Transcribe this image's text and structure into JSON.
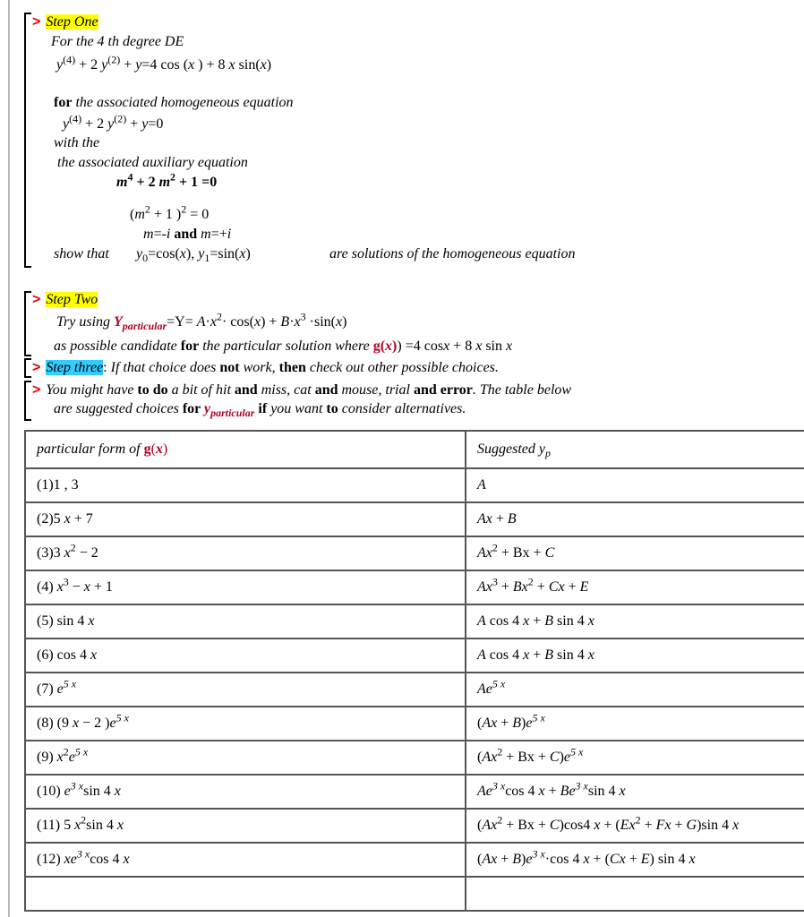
{
  "prompt": ">",
  "colors": {
    "prompt": "#e00000",
    "highlight_step": "#ffff00",
    "highlight_step_three": "#33ccff",
    "emphasis": "#b00020"
  },
  "step_one": {
    "title": [
      [
        "i hly",
        "Step One"
      ]
    ],
    "line1": [
      [
        "i",
        "For the 4 th degree DE"
      ]
    ],
    "de": [
      [
        "i",
        "y"
      ],
      [
        "sup",
        "(4)"
      ],
      [
        "",
        "  + 2 "
      ],
      [
        "i",
        "y"
      ],
      [
        "sup",
        "(2)"
      ],
      [
        "",
        "  + "
      ],
      [
        "i",
        "y"
      ],
      [
        "",
        "=4 cos ("
      ],
      [
        "i",
        "x"
      ],
      [
        "",
        " )  + 8 "
      ],
      [
        "i",
        "x"
      ],
      [
        "",
        " sin("
      ],
      [
        "i",
        "x"
      ],
      [
        "",
        ")"
      ]
    ],
    "line2": [
      [
        "b",
        "for"
      ],
      [
        "i",
        " the   associated homogeneous  equation"
      ]
    ],
    "hom": [
      [
        "i",
        "y"
      ],
      [
        "sup",
        "(4)"
      ],
      [
        "",
        "  + 2 "
      ],
      [
        "i",
        "y"
      ],
      [
        "sup",
        "(2)"
      ],
      [
        "",
        "  + "
      ],
      [
        "i",
        "y"
      ],
      [
        "",
        "=0"
      ]
    ],
    "line3": [
      [
        "i",
        "with the"
      ]
    ],
    "line4": [
      [
        "i",
        "the associated auxiliary equation"
      ]
    ],
    "aux": [
      [
        "b i",
        "m"
      ],
      [
        "b sup",
        "4"
      ],
      [
        "b",
        " + 2 "
      ],
      [
        "b i",
        "m"
      ],
      [
        "b sup",
        "2"
      ],
      [
        "b",
        " + 1 =0"
      ]
    ],
    "factored": [
      [
        "",
        "("
      ],
      [
        "i",
        "m"
      ],
      [
        "sup",
        "2"
      ],
      [
        "",
        " + 1 )"
      ],
      [
        "sup",
        "2"
      ],
      [
        "",
        "  =  0"
      ]
    ],
    "roots": [
      [
        "i",
        "m"
      ],
      [
        "",
        "=-"
      ],
      [
        "i",
        "i"
      ],
      [
        "b",
        "   and  "
      ],
      [
        "i",
        "m"
      ],
      [
        "",
        "=+"
      ],
      [
        "i",
        "i"
      ]
    ],
    "show_label": [
      [
        "i",
        "show that"
      ]
    ],
    "solutions": [
      [
        "i",
        "y"
      ],
      [
        "sub",
        "0"
      ],
      [
        "",
        "=cos("
      ],
      [
        "i",
        "x"
      ],
      [
        "",
        "),  "
      ],
      [
        "i",
        "y"
      ],
      [
        "sub",
        "1"
      ],
      [
        "",
        "=sin("
      ],
      [
        "i",
        "x"
      ],
      [
        "",
        ")"
      ]
    ],
    "conclusion": [
      [
        "i",
        "are solutions of the homogeneous equation"
      ]
    ]
  },
  "step_two": {
    "title": [
      [
        "i hly",
        "Step Two"
      ]
    ],
    "line1": [
      [
        "i",
        "Try  using    "
      ],
      [
        "b i red",
        "Y"
      ],
      [
        "b i red sub",
        "particular"
      ],
      [
        "",
        "=Y=   "
      ],
      [
        "i",
        "A"
      ],
      [
        "",
        "·"
      ],
      [
        "i",
        "x"
      ],
      [
        "sup",
        "2"
      ],
      [
        "",
        "·  cos("
      ],
      [
        "i",
        "x"
      ],
      [
        "",
        ")  + "
      ],
      [
        "i",
        "B"
      ],
      [
        "",
        "·"
      ],
      [
        "i",
        "x"
      ],
      [
        "sup",
        "3"
      ],
      [
        "",
        "  ·sin("
      ],
      [
        "i",
        "x"
      ],
      [
        "",
        ")"
      ]
    ],
    "line2": [
      [
        "i",
        "as possible candidate "
      ],
      [
        "b",
        "for"
      ],
      [
        "i",
        " the  particular solution  where  "
      ],
      [
        "b red",
        "g"
      ],
      [
        "b red",
        "("
      ],
      [
        "b i red",
        "x"
      ],
      [
        "b red",
        ")"
      ],
      [
        "",
        ") =4 cos"
      ],
      [
        "i",
        "x"
      ],
      [
        "",
        " + 8 "
      ],
      [
        "i",
        "x"
      ],
      [
        "",
        " sin "
      ],
      [
        "i",
        "x"
      ]
    ]
  },
  "step_three": {
    "line": [
      [
        "i hlb",
        "Step three"
      ],
      [
        "",
        ":  "
      ],
      [
        "i",
        "If that choice does "
      ],
      [
        "b",
        "not"
      ],
      [
        "i",
        " work, "
      ],
      [
        "b",
        "then"
      ],
      [
        "i",
        " check out other possible choices."
      ]
    ]
  },
  "note": {
    "line1": [
      [
        "i",
        "You might have "
      ],
      [
        "b",
        "to  do"
      ],
      [
        "i",
        " a bit of hit "
      ],
      [
        "b",
        "and"
      ],
      [
        "i",
        " miss, cat "
      ],
      [
        "b",
        "and"
      ],
      [
        "i",
        " mouse, trial "
      ],
      [
        "b",
        "and error"
      ],
      [
        "i",
        ". The table below"
      ]
    ],
    "line2": [
      [
        "i",
        "are suggested choices  "
      ],
      [
        "b",
        "for "
      ],
      [
        "b i red",
        "y"
      ],
      [
        "b i red sub",
        "particular"
      ],
      [
        "b",
        "    if "
      ],
      [
        "i",
        "you want "
      ],
      [
        "b",
        "to"
      ],
      [
        "i",
        " consider alternatives."
      ]
    ]
  },
  "table": {
    "headers": [
      [
        [
          "i",
          "particular form  of  "
        ],
        [
          "b red",
          "g"
        ],
        [
          "red",
          "("
        ],
        [
          "b i red",
          "x"
        ],
        [
          "red",
          ")"
        ]
      ],
      [
        [
          "i",
          "Suggested   y"
        ],
        [
          "i sub",
          "p"
        ]
      ]
    ],
    "rows": [
      [
        [
          [
            "",
            "(1)1 , 3"
          ]
        ],
        [
          [
            "i",
            "A"
          ]
        ]
      ],
      [
        [
          [
            "",
            "(2)5 "
          ],
          [
            "i",
            "x"
          ],
          [
            "",
            " + 7"
          ]
        ],
        [
          [
            "i",
            "Ax"
          ],
          [
            "",
            " + "
          ],
          [
            "i",
            "B"
          ]
        ]
      ],
      [
        [
          [
            "",
            "(3)3 "
          ],
          [
            "i",
            "x"
          ],
          [
            "sup",
            "2"
          ],
          [
            "",
            " − 2"
          ]
        ],
        [
          [
            "i",
            "Ax"
          ],
          [
            "sup",
            "2"
          ],
          [
            "",
            " + Bx + "
          ],
          [
            "i",
            "C"
          ]
        ]
      ],
      [
        [
          [
            "",
            "(4)  "
          ],
          [
            "i",
            "x"
          ],
          [
            "sup",
            "3"
          ],
          [
            "",
            " − "
          ],
          [
            "i",
            "x"
          ],
          [
            "",
            " + 1"
          ]
        ],
        [
          [
            "i",
            "Ax"
          ],
          [
            "sup",
            "3"
          ],
          [
            "",
            " + "
          ],
          [
            "i",
            "Bx"
          ],
          [
            "sup",
            "2"
          ],
          [
            "",
            " + "
          ],
          [
            "i",
            "Cx"
          ],
          [
            "",
            " + "
          ],
          [
            "i",
            "E"
          ]
        ]
      ],
      [
        [
          [
            "",
            "(5)  sin 4 "
          ],
          [
            "i",
            "x"
          ]
        ],
        [
          [
            "i",
            "A"
          ],
          [
            "",
            " cos 4 "
          ],
          [
            "i",
            "x"
          ],
          [
            "",
            " + "
          ],
          [
            "i",
            "B"
          ],
          [
            "",
            " sin 4 "
          ],
          [
            "i",
            "x"
          ]
        ]
      ],
      [
        [
          [
            "",
            "(6)  cos 4 "
          ],
          [
            "i",
            "x"
          ]
        ],
        [
          [
            "i",
            "A"
          ],
          [
            "",
            " cos 4 "
          ],
          [
            "i",
            "x"
          ],
          [
            "",
            " + "
          ],
          [
            "i",
            "B"
          ],
          [
            "",
            " sin 4 "
          ],
          [
            "i",
            "x"
          ]
        ]
      ],
      [
        [
          [
            "",
            "(7)   "
          ],
          [
            "i",
            "e"
          ],
          [
            "i sup",
            "5 x"
          ]
        ],
        [
          [
            "i",
            "Ae"
          ],
          [
            "i sup",
            "5 x"
          ]
        ]
      ],
      [
        [
          [
            "",
            "(8)  (9 "
          ],
          [
            "i",
            "x"
          ],
          [
            "",
            " − 2 )"
          ],
          [
            "i",
            "e"
          ],
          [
            "i sup",
            "5 x"
          ]
        ],
        [
          [
            "",
            "("
          ],
          [
            "i",
            "Ax"
          ],
          [
            "",
            " + "
          ],
          [
            "i",
            "B"
          ],
          [
            "",
            ")"
          ],
          [
            "i",
            "e"
          ],
          [
            "i sup",
            "5 x"
          ]
        ]
      ],
      [
        [
          [
            "",
            "(9)  "
          ],
          [
            "i",
            "x"
          ],
          [
            "sup",
            "2"
          ],
          [
            "i",
            "e"
          ],
          [
            "i sup",
            "5 x"
          ]
        ],
        [
          [
            "",
            "("
          ],
          [
            "i",
            "Ax"
          ],
          [
            "sup",
            "2"
          ],
          [
            "",
            " + Bx + "
          ],
          [
            "i",
            "C"
          ],
          [
            "",
            ")"
          ],
          [
            "i",
            "e"
          ],
          [
            "i sup",
            "5 x"
          ]
        ]
      ],
      [
        [
          [
            "",
            "(10) "
          ],
          [
            "i",
            "e"
          ],
          [
            "i sup",
            "3 x"
          ],
          [
            "",
            "sin 4 "
          ],
          [
            "i",
            "x"
          ]
        ],
        [
          [
            "i",
            "Ae"
          ],
          [
            "i sup",
            "3 x"
          ],
          [
            "",
            "cos 4 "
          ],
          [
            "i",
            "x"
          ],
          [
            "",
            " + "
          ],
          [
            "i",
            "Be"
          ],
          [
            "i sup",
            "3 x"
          ],
          [
            "",
            "sin 4 "
          ],
          [
            "i",
            "x"
          ]
        ]
      ],
      [
        [
          [
            "",
            "(11) 5 "
          ],
          [
            "i",
            "x"
          ],
          [
            "sup",
            "2"
          ],
          [
            "",
            "sin 4 "
          ],
          [
            "i",
            "x"
          ]
        ],
        [
          [
            "",
            "("
          ],
          [
            "i",
            "Ax"
          ],
          [
            "sup",
            "2"
          ],
          [
            "",
            " + Bx + "
          ],
          [
            "i",
            "C"
          ],
          [
            "",
            ")cos4 "
          ],
          [
            "i",
            "x"
          ],
          [
            "",
            " + ("
          ],
          [
            "i",
            "Ex"
          ],
          [
            "sup",
            "2"
          ],
          [
            "",
            " + "
          ],
          [
            "i",
            "Fx"
          ],
          [
            "",
            " + "
          ],
          [
            "i",
            "G"
          ],
          [
            "",
            ")sin 4 "
          ],
          [
            "i",
            "x"
          ]
        ]
      ],
      [
        [
          [
            "",
            "(12) "
          ],
          [
            "i",
            "xe"
          ],
          [
            "i sup",
            "3 x"
          ],
          [
            "",
            "cos 4 "
          ],
          [
            "i",
            "x"
          ]
        ],
        [
          [
            "",
            "("
          ],
          [
            "i",
            "Ax"
          ],
          [
            "",
            " + "
          ],
          [
            "i",
            "B"
          ],
          [
            "",
            ")"
          ],
          [
            "i",
            "e"
          ],
          [
            "i sup",
            "3 x"
          ],
          [
            "",
            "·cos 4 "
          ],
          [
            "i",
            "x"
          ],
          [
            "",
            " + ("
          ],
          [
            "i",
            "Cx"
          ],
          [
            "",
            " + "
          ],
          [
            "i",
            "E"
          ],
          [
            "",
            ") sin 4 "
          ],
          [
            "i",
            "x"
          ]
        ]
      ]
    ]
  }
}
